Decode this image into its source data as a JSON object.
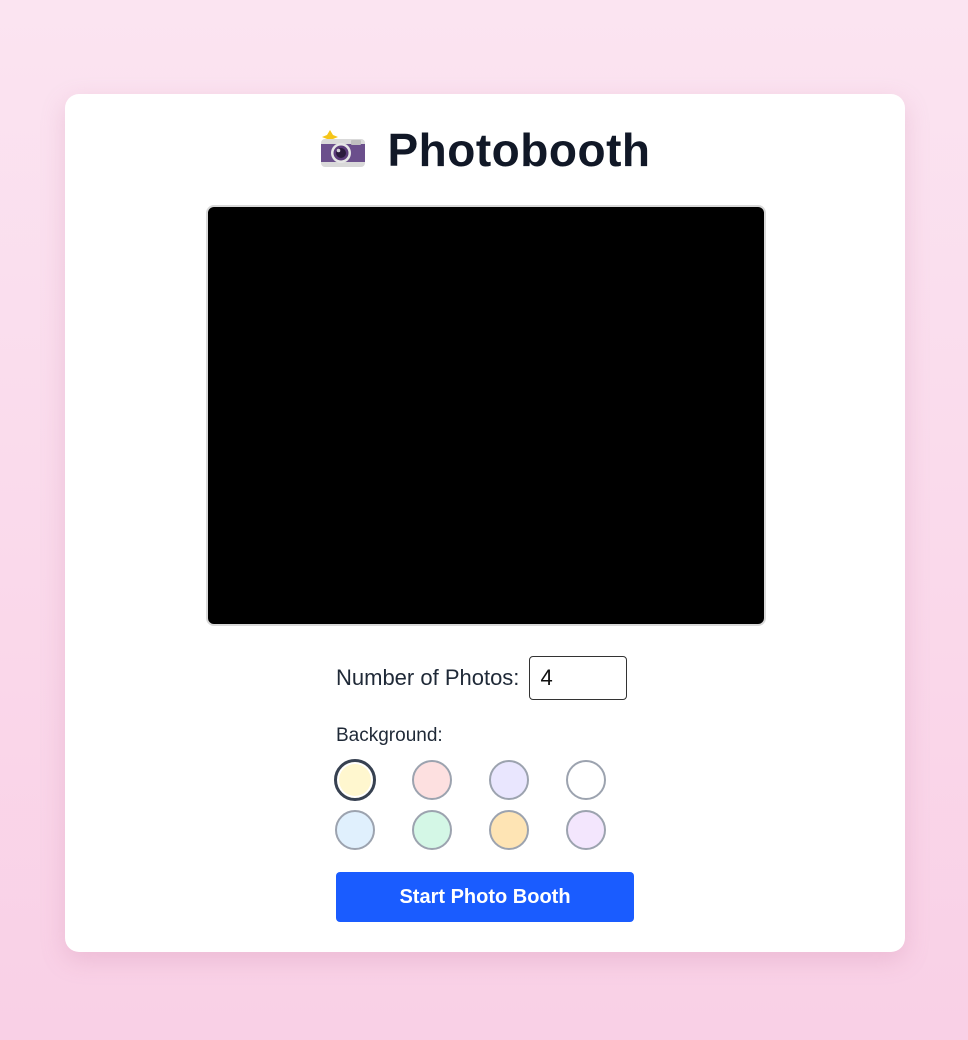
{
  "app": {
    "title": "Photobooth",
    "title_icon": "camera-with-flash-icon"
  },
  "camera": {
    "preview_state": "black"
  },
  "photos": {
    "label": "Number of Photos:",
    "value": "4"
  },
  "background": {
    "label": "Background:",
    "selected_index": 0,
    "swatches": [
      {
        "name": "yellow",
        "color": "#fff7cf"
      },
      {
        "name": "pink",
        "color": "#fde0e0"
      },
      {
        "name": "lavender",
        "color": "#e9e6fe"
      },
      {
        "name": "white",
        "color": "#ffffff"
      },
      {
        "name": "light-blue",
        "color": "#e0f0fd"
      },
      {
        "name": "mint",
        "color": "#d4f7e6"
      },
      {
        "name": "peach",
        "color": "#fee4b4"
      },
      {
        "name": "lilac",
        "color": "#f3e6fd"
      }
    ]
  },
  "actions": {
    "start_label": "Start Photo Booth"
  },
  "colors": {
    "accent": "#1a5cff",
    "title": "#111827"
  }
}
